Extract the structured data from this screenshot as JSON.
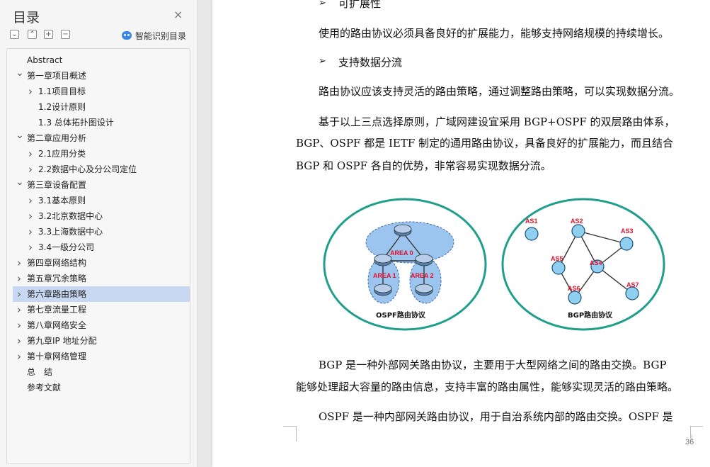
{
  "sidebar": {
    "title": "目录",
    "close_symbol": "×",
    "tools": [
      "expand-all",
      "collapse-all",
      "expand-level",
      "collapse-level"
    ],
    "smart_toc_label": "智能识别目录",
    "items": [
      {
        "label": "Abstract",
        "level": 0,
        "chevron": "none"
      },
      {
        "label": "第一章项目概述",
        "level": 0,
        "chevron": "down"
      },
      {
        "label": "1.1项目目标",
        "level": 1,
        "chevron": "right"
      },
      {
        "label": "1.2设计原则",
        "level": 1,
        "chevron": "none"
      },
      {
        "label": "1.3 总体拓扑图设计",
        "level": 1,
        "chevron": "none"
      },
      {
        "label": "第二章应用分析",
        "level": 0,
        "chevron": "down"
      },
      {
        "label": "2.1应用分类",
        "level": 1,
        "chevron": "right"
      },
      {
        "label": "2.2数据中心及分公司定位",
        "level": 1,
        "chevron": "right"
      },
      {
        "label": "第三章设备配置",
        "level": 0,
        "chevron": "down"
      },
      {
        "label": "3.1基本原则",
        "level": 1,
        "chevron": "right"
      },
      {
        "label": "3.2北京数据中心",
        "level": 1,
        "chevron": "right"
      },
      {
        "label": "3.3上海数据中心",
        "level": 1,
        "chevron": "right"
      },
      {
        "label": "3.4一级分公司",
        "level": 1,
        "chevron": "right"
      },
      {
        "label": "第四章网络结构",
        "level": 0,
        "chevron": "right"
      },
      {
        "label": "第五章冗余策略",
        "level": 0,
        "chevron": "right"
      },
      {
        "label": "第六章路由策略",
        "level": 0,
        "chevron": "right",
        "selected": true
      },
      {
        "label": "第七章流量工程",
        "level": 0,
        "chevron": "right"
      },
      {
        "label": "第八章网络安全",
        "level": 0,
        "chevron": "right"
      },
      {
        "label": "第九章IP 地址分配",
        "level": 0,
        "chevron": "right"
      },
      {
        "label": "第十章网络管理",
        "level": 0,
        "chevron": "right"
      },
      {
        "label": "总　结",
        "level": 0,
        "chevron": "none"
      },
      {
        "label": "参考文献",
        "level": 0,
        "chevron": "none"
      }
    ]
  },
  "document": {
    "bullet1": "可扩展性",
    "para1": "使用的路由协议必须具备良好的扩展能力，能够支持网络规模的持续增长。",
    "bullet2": "支持数据分流",
    "para2": "路由协议应该支持灵活的路由策略，通过调整路由策略，可以实现数据分流。",
    "para3_l1": "基于以上三点选择原则，广域网建设宜采用 BGP+OSPF 的双层路由体系，",
    "para3_l2": "BGP、OSPF 都是 IETF 制定的通用路由协议，具备良好的扩展能力，而且结合",
    "para3_l3": "BGP 和 OSPF 各自的优势，非常容易实现数据分流。",
    "para4_l1": "BGP 是一种外部网关路由协议，主要用于大型网络之间的路由交换。BGP",
    "para4_l2": "能够处理超大容量的路由信息，支持丰富的路由属性，能够实现灵活的路由策略。",
    "para5_l1": "OSPF 是一种内部网关路由协议，用于自治系统内部的路由交换。OSPF 是",
    "page_number": "36"
  },
  "figure": {
    "ospf_caption": "OSPF路由协议",
    "bgp_caption": "BGP路由协议",
    "area0": "AREA 0",
    "area1": "AREA 1",
    "area2": "AREA 2",
    "as_labels": [
      "AS1",
      "AS2",
      "AS3",
      "AS5",
      "AS4",
      "AS6",
      "AS7"
    ],
    "colors": {
      "ellipse": "#1f9e8c",
      "node": "#8fd0f0",
      "label_red": "#e0102a",
      "area": "#9bc4ee"
    }
  }
}
